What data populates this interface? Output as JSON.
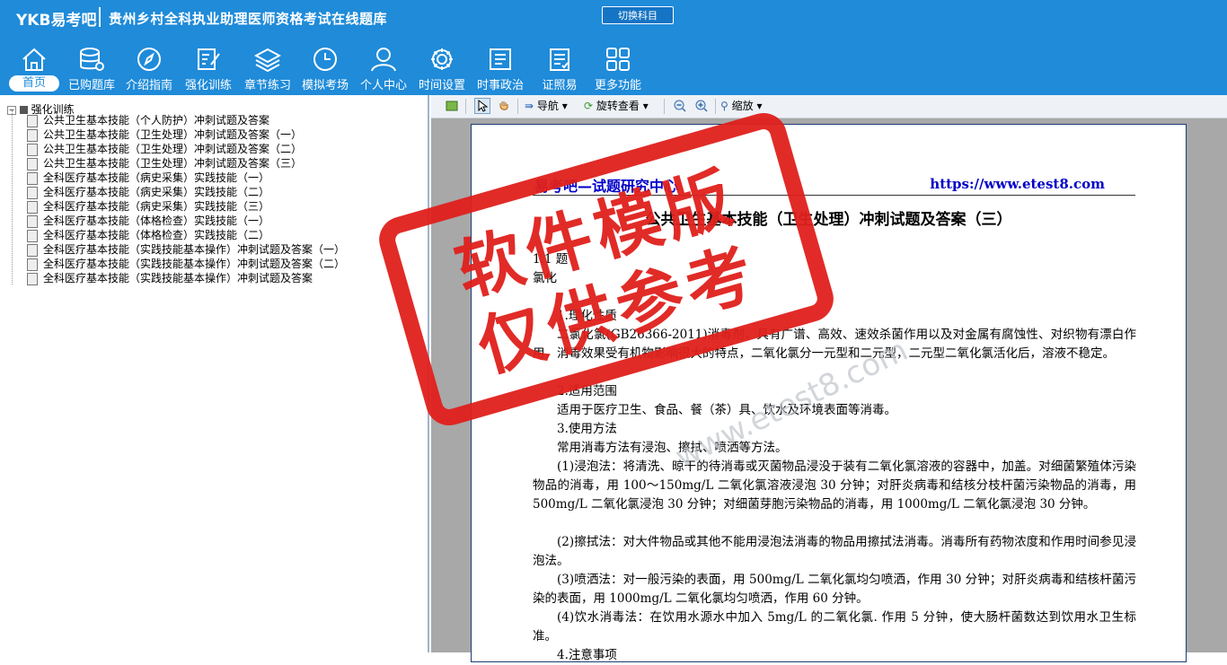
{
  "header": {
    "logo": "YKB易考吧",
    "title": "贵州乡村全科执业助理医师资格考试在线题库",
    "switch_button": "切换科目"
  },
  "nav": [
    {
      "label": "首页",
      "icon": "home-icon",
      "active": true
    },
    {
      "label": "已购题库",
      "icon": "database-icon"
    },
    {
      "label": "介绍指南",
      "icon": "compass-icon"
    },
    {
      "label": "强化训练",
      "icon": "edit-icon"
    },
    {
      "label": "章节练习",
      "icon": "layers-icon"
    },
    {
      "label": "模拟考场",
      "icon": "clock-icon"
    },
    {
      "label": "个人中心",
      "icon": "user-icon"
    },
    {
      "label": "时间设置",
      "icon": "gear-icon"
    },
    {
      "label": "时事政治",
      "icon": "news-icon"
    },
    {
      "label": "证照易",
      "icon": "list-icon"
    },
    {
      "label": "更多功能",
      "icon": "grid-icon"
    }
  ],
  "tree": {
    "root": "强化训练",
    "items": [
      "公共卫生基本技能（个人防护）冲刺试题及答案",
      "公共卫生基本技能（卫生处理）冲刺试题及答案（一）",
      "公共卫生基本技能（卫生处理）冲刺试题及答案（二）",
      "公共卫生基本技能（卫生处理）冲刺试题及答案（三）",
      "全科医疗基本技能（病史采集）实践技能（一）",
      "全科医疗基本技能（病史采集）实践技能（二）",
      "全科医疗基本技能（病史采集）实践技能（三）",
      "全科医疗基本技能（体格检查）实践技能（一）",
      "全科医疗基本技能（体格检查）实践技能（二）",
      "全科医疗基本技能（实践技能基本操作）冲刺试题及答案（一）",
      "全科医疗基本技能（实践技能基本操作）冲刺试题及答案（二）",
      "全科医疗基本技能（实践技能基本操作）冲刺试题及答案"
    ]
  },
  "toolbar": {
    "nav": "导航",
    "rotate": "旋转查看",
    "zoom": "缩放"
  },
  "document": {
    "head_left": "易考吧—试题研究中心",
    "head_right": "https://www.etest8.com",
    "title": "公共卫生基本技能（卫生处理）冲刺试题及答案（三）",
    "lines": [
      "1.1 题",
      "氯化",
      "1.理化性质",
      "二氯化氯(GB26366-2011)消毒剂，具有广谱、高效、速效杀菌作用以及对金属有腐蚀性、对织物有漂白作用，消毒效果受有机物影响很大的特点，二氧化氯分一元型和二元型，二元型二氧化氯活化后，溶液不稳定。",
      "2.适用范围",
      "适用于医疗卫生、食品、餐（茶）具、饮水及环境表面等消毒。",
      "3.使用方法",
      "常用消毒方法有浸泡、擦拭、喷洒等方法。",
      "(1)浸泡法：将清洗、晾干的待消毒或灭菌物品浸没于装有二氧化氯溶液的容器中，加盖。对细菌繁殖体污染物品的消毒，用 100～150mg/L 二氧化氯溶液浸泡 30 分钟；对肝炎病毒和结核分枝杆菌污染物品的消毒，用 500mg/L 二氧化氯浸泡 30 分钟；对细菌芽胞污染物品的消毒，用 1000mg/L 二氧化氯浸泡 30 分钟。",
      "(2)擦拭法：对大件物品或其他不能用浸泡法消毒的物品用擦拭法消毒。消毒所有药物浓度和作用时间参见浸泡法。",
      "(3)喷洒法：对一般污染的表面，用 500mg/L 二氧化氯均匀喷洒，作用 30 分钟；对肝炎病毒和结核杆菌污染的表面，用 1000mg/L 二氧化氯均匀喷洒，作用 60 分钟。",
      "(4)饮水消毒法：在饮用水源水中加入 5mg/L 的二氧化氯. 作用 5 分钟，使大肠杆菌数达到饮用水卫生标准。",
      "4.注意事项"
    ]
  },
  "stamp": {
    "line1": "软件模版",
    "line2": "仅供参考"
  },
  "watermark": "www.etest8.com",
  "colors": {
    "header_bg": "#1f8bd9",
    "stamp_red": "#e0201c",
    "doc_blue": "#0000c8"
  }
}
